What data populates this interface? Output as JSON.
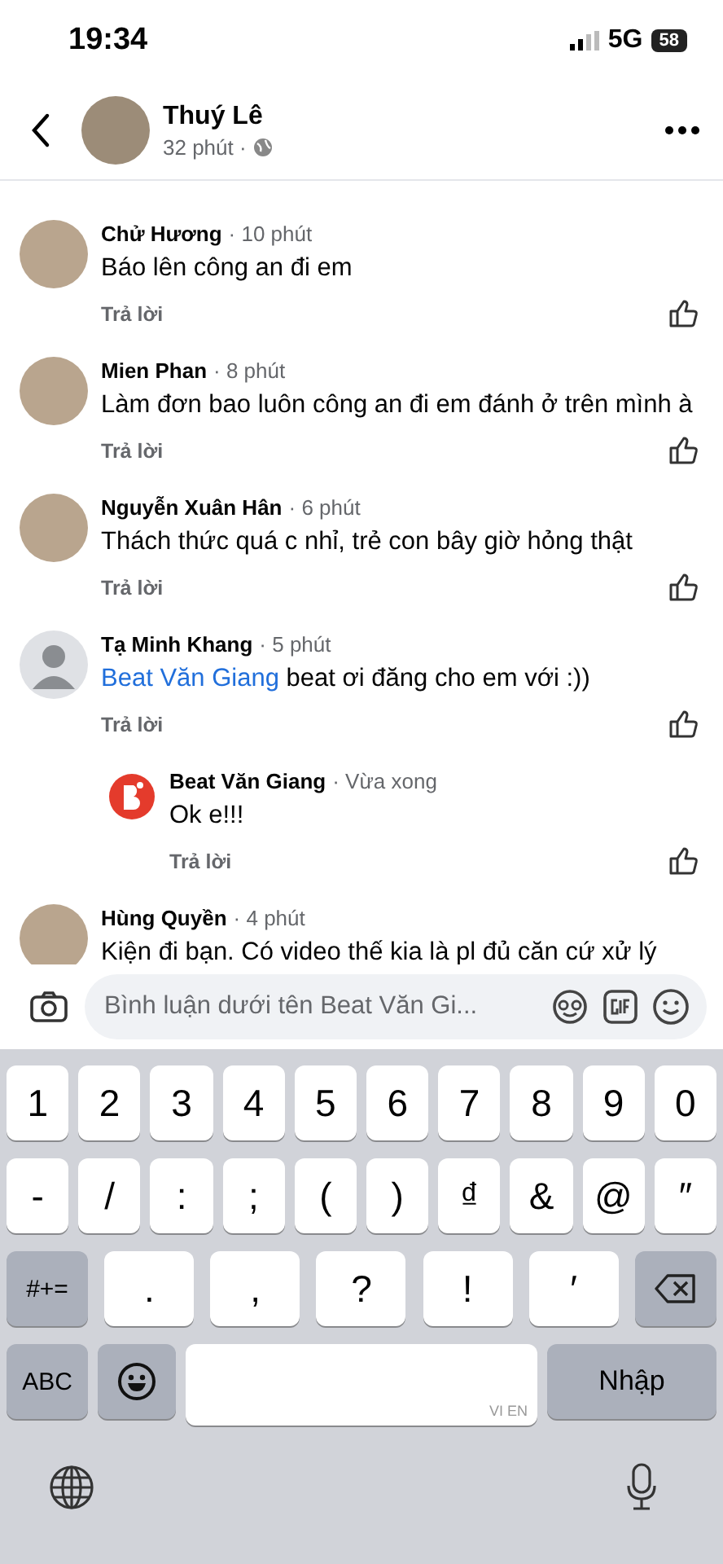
{
  "status_bar": {
    "time": "19:34",
    "network": "5G",
    "battery": "58"
  },
  "header": {
    "name": "Thuý Lê",
    "time": "32 phút ·"
  },
  "comments": [
    {
      "author": "Chử Hương",
      "time": "· 10 phút",
      "kind": "photo",
      "text": "Báo lên công an đi em",
      "reply": "Trả lời"
    },
    {
      "author": "Mien Phan",
      "time": "· 8 phút",
      "kind": "photo",
      "text": "Làm đơn bao luôn công an đi em đánh ở trên mình à",
      "reply": "Trả lời"
    },
    {
      "author": "Nguyễn Xuân Hân",
      "time": "· 6 phút",
      "kind": "photo",
      "text": "Thách thức quá c nhỉ, trẻ con bây giờ hỏng thật",
      "reply": "Trả lời"
    },
    {
      "author": "Tạ Minh Khang",
      "time": "· 5 phút",
      "kind": "default",
      "mention": "Beat Văn Giang",
      "text": "beat ơi đăng cho em với :))",
      "reply": "Trả lời",
      "replies": [
        {
          "author": "Beat Văn Giang",
          "time": "· Vừa xong",
          "kind": "logo",
          "text": "Ok e!!!",
          "reply": "Trả lời"
        }
      ]
    },
    {
      "author": "Hùng Quyền",
      "time": "· 4 phút",
      "kind": "photo",
      "text": "Kiện đi bạn. Có video thế kia là pl đủ căn cứ xử lý"
    }
  ],
  "composer": {
    "placeholder": "Bình luận dưới tên Beat Văn Gi..."
  },
  "keyboard": {
    "number_row": [
      {
        "kind": "char",
        "label": "1"
      },
      {
        "kind": "char",
        "label": "2"
      },
      {
        "kind": "char",
        "label": "3"
      },
      {
        "kind": "char",
        "label": "4"
      },
      {
        "kind": "char",
        "label": "5"
      },
      {
        "kind": "char",
        "label": "6"
      },
      {
        "kind": "char",
        "label": "7"
      },
      {
        "kind": "char",
        "label": "8"
      },
      {
        "kind": "char",
        "label": "9"
      },
      {
        "kind": "char",
        "label": "0"
      }
    ],
    "symbol_row": [
      {
        "kind": "char",
        "label": "-"
      },
      {
        "kind": "char",
        "label": "/"
      },
      {
        "kind": "char",
        "label": ":"
      },
      {
        "kind": "char",
        "label": ";"
      },
      {
        "kind": "char",
        "label": "("
      },
      {
        "kind": "char",
        "label": ")"
      },
      {
        "kind": "char",
        "label": "₫"
      },
      {
        "kind": "char",
        "label": "&"
      },
      {
        "kind": "char",
        "label": "@"
      },
      {
        "kind": "char",
        "label": "″"
      }
    ],
    "punctuation_row": [
      {
        "kind": "fn",
        "label": "#+="
      },
      {
        "kind": "wide",
        "label": "."
      },
      {
        "kind": "wide",
        "label": ","
      },
      {
        "kind": "wide",
        "label": "?"
      },
      {
        "kind": "wide",
        "label": "!"
      },
      {
        "kind": "wide",
        "label": "′"
      },
      {
        "kind": "delete"
      }
    ],
    "bottom_row": [
      {
        "kind": "fn",
        "label": "ABC"
      },
      {
        "kind": "emoji"
      },
      {
        "kind": "space",
        "label": "VI EN"
      },
      {
        "kind": "return",
        "label": "Nhập"
      }
    ]
  }
}
